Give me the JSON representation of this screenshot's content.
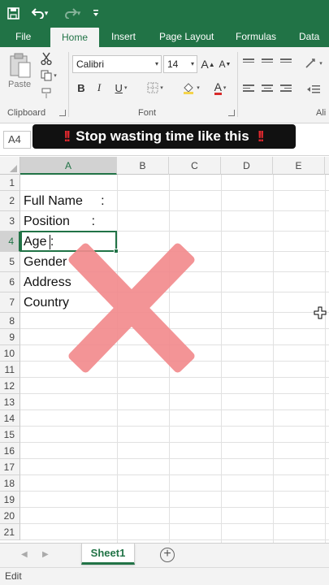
{
  "ribbon_tabs": [
    {
      "label": "File"
    },
    {
      "label": "Home"
    },
    {
      "label": "Insert"
    },
    {
      "label": "Page Layout"
    },
    {
      "label": "Formulas"
    },
    {
      "label": "Data"
    }
  ],
  "clipboard": {
    "paste_label": "Paste",
    "group_label": "Clipboard"
  },
  "font": {
    "name": "Calibri",
    "size": "14",
    "group_label": "Font",
    "bold": "B",
    "italic": "I",
    "underline": "U",
    "grow": "A",
    "shrink": "A",
    "font_color_glyph": "A"
  },
  "alignment": {
    "group_label": "Ali"
  },
  "name_box": "A4",
  "banner": {
    "text": "Stop wasting time like this",
    "bang_left": "!!",
    "bang_right": "!!"
  },
  "columns": [
    "A",
    "B",
    "C",
    "D",
    "E"
  ],
  "selected_column": "A",
  "selected_row": 4,
  "rows": [
    "1",
    "2",
    "3",
    "4",
    "5",
    "6",
    "7",
    "8",
    "9",
    "10",
    "11",
    "12",
    "13",
    "14",
    "15",
    "16",
    "17",
    "18",
    "19",
    "20",
    "21"
  ],
  "cells": [
    {
      "row": 2,
      "text": "Full Name     :"
    },
    {
      "row": 3,
      "text": "Position      :"
    },
    {
      "row": 4,
      "text": "Age :"
    },
    {
      "row": 5,
      "text": "Gender"
    },
    {
      "row": 6,
      "text": "Address"
    },
    {
      "row": 7,
      "text": "Country"
    }
  ],
  "sheet_tab": "Sheet1",
  "add_sheet": "+",
  "status": "Edit",
  "colors": {
    "excel_green": "#217346",
    "x_mark": "#f28b8e"
  }
}
